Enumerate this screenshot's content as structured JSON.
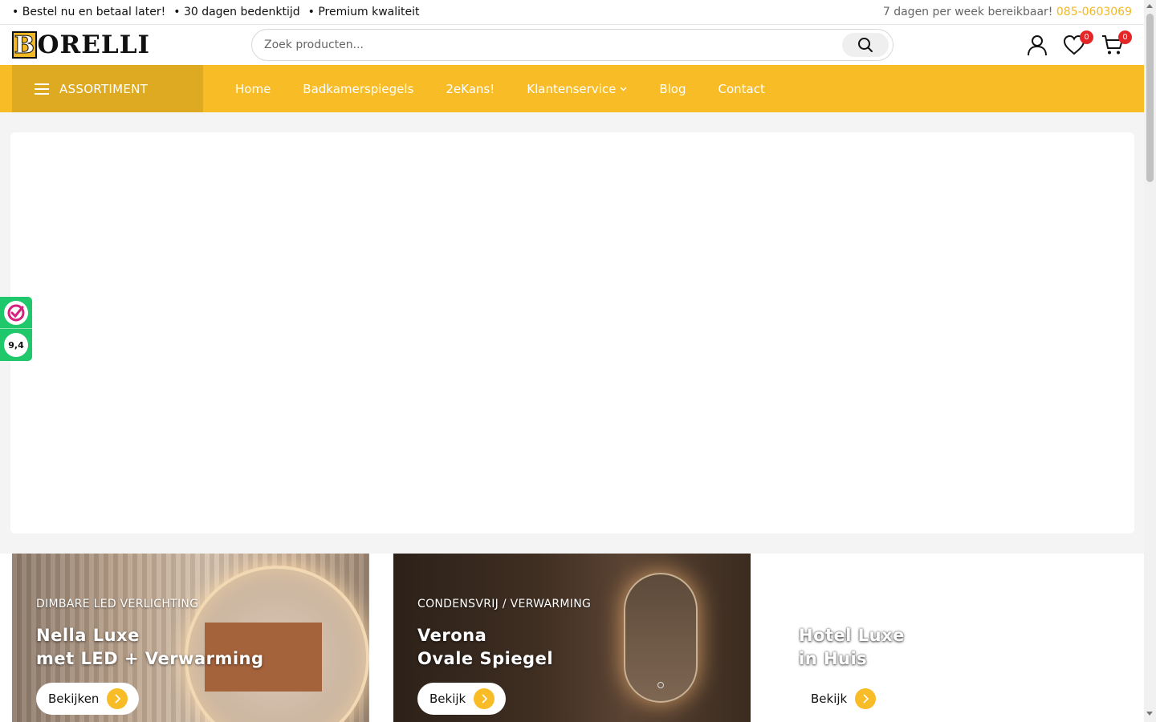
{
  "topbar": {
    "usps": [
      "• Bestel nu en betaal later!",
      "• 30 dagen bedenktijd",
      "• Premium kwaliteit"
    ],
    "contact_text": "7 dagen per week bereikbaar!",
    "phone": "085-0603069"
  },
  "header": {
    "logo_initial": "B",
    "logo_rest": "ORELLI",
    "search_placeholder": "Zoek producten...",
    "wishlist_count": "0",
    "cart_count": "0"
  },
  "nav": {
    "assortiment_label": "ASSORTIMENT",
    "items": [
      "Home",
      "Badkamerspiegels",
      "2eKans!",
      "Klantenservice",
      "Blog",
      "Contact"
    ]
  },
  "promos": [
    {
      "kicker": "DIMBARE LED VERLICHTING",
      "title_line1": "Nella Luxe",
      "title_line2": "met LED + Verwarming",
      "cta": "Bekijken"
    },
    {
      "kicker": "CONDENSVRIJ / VERWARMING",
      "title_line1": "Verona",
      "title_line2": "Ovale Spiegel",
      "cta": "Bekijk"
    },
    {
      "kicker": "",
      "title_line1": "Hotel Luxe",
      "title_line2": "in Huis",
      "cta": "Bekijk"
    }
  ],
  "review_widget": {
    "score": "9,4"
  },
  "colors": {
    "brand_yellow": "#f8bc26",
    "brand_yellow_dark": "#ddaa22",
    "badge_red": "#e52626",
    "review_green": "#1fc86a"
  }
}
